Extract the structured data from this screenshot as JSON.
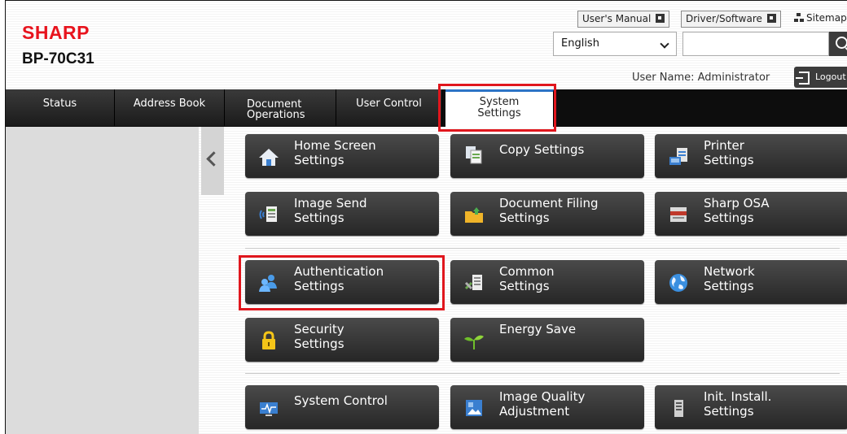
{
  "header": {
    "brand": "SHARP",
    "model": "BP-70C31",
    "users_manual": "User's Manual",
    "driver_software": "Driver/Software",
    "sitemap": "Sitemap",
    "language": "English",
    "search_placeholder": "",
    "user_label": "User Name: Administrator",
    "logout": "Logout"
  },
  "tabs": [
    {
      "line1": "Status",
      "line2": ""
    },
    {
      "line1": "Address Book",
      "line2": ""
    },
    {
      "line1": "Document",
      "line2": "Operations"
    },
    {
      "line1": "User Control",
      "line2": ""
    },
    {
      "line1": "System",
      "line2": "Settings"
    }
  ],
  "active_tab": "System Settings",
  "tiles": [
    {
      "label": "Home Screen\nSettings",
      "icon": "home-icon"
    },
    {
      "label": "Copy Settings",
      "icon": "copy-icon"
    },
    {
      "label": "Printer\nSettings",
      "icon": "printer-icon"
    },
    {
      "label": "Image Send\nSettings",
      "icon": "image-send-icon"
    },
    {
      "label": "Document Filing\nSettings",
      "icon": "folder-icon"
    },
    {
      "label": "Sharp OSA\nSettings",
      "icon": "osa-icon"
    },
    {
      "label": "Authentication\nSettings",
      "icon": "users-icon"
    },
    {
      "label": "Common\nSettings",
      "icon": "common-settings-icon"
    },
    {
      "label": "Network\nSettings",
      "icon": "globe-icon"
    },
    {
      "label": "Security\nSettings",
      "icon": "lock-icon"
    },
    {
      "label": "Energy Save",
      "icon": "leaf-icon"
    },
    {
      "label": "System Control",
      "icon": "monitor-icon"
    },
    {
      "label": "Image Quality\nAdjustment",
      "icon": "image-quality-icon"
    },
    {
      "label": "Init. Install.\nSettings",
      "icon": "tower-icon"
    }
  ],
  "colors": {
    "brand_red": "#e8141e",
    "highlight_red": "#e0161d",
    "tab_accent": "#2c74c6",
    "tile_dark": "#2e2e2e"
  }
}
